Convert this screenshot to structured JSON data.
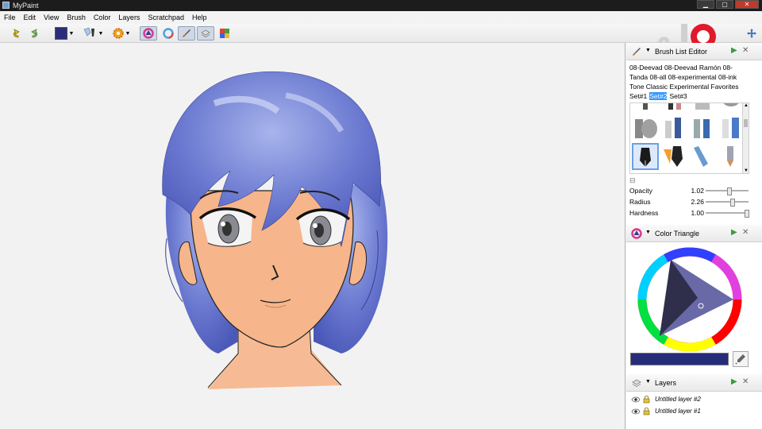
{
  "window": {
    "title": "MyPaint",
    "min_label": "▁",
    "max_label": "▢",
    "close_label": "✕"
  },
  "menu": [
    "File",
    "Edit",
    "View",
    "Brush",
    "Color",
    "Layers",
    "Scratchpad",
    "Help"
  ],
  "toolbar": {
    "current_color": "#2b2d7a"
  },
  "brush_panel": {
    "title": "Brush List Editor",
    "groups_line1": "08-Deevad 08-Deevad Ramón 08-",
    "groups_line2": "Tanda 08-all 08-experimental 08-ink",
    "groups_line3": "Tone Classic Experimental Favorites",
    "sets": [
      "Set#1",
      "Set#2",
      "Set#3"
    ],
    "selected_set": "Set#2",
    "collapse_label": "⊟",
    "sliders": [
      {
        "label": "Opacity",
        "value": "1.02",
        "position": 0.55
      },
      {
        "label": "Radius",
        "value": "2.26",
        "position": 0.62
      },
      {
        "label": "Hardness",
        "value": "1.00",
        "position": 1.0
      }
    ]
  },
  "color_panel": {
    "title": "Color Triangle",
    "selected_color": "#252d78"
  },
  "layers_panel": {
    "title": "Layers",
    "layers": [
      "Untitled layer #2",
      "Untitled layer #1"
    ]
  },
  "colors": {
    "accent": "#3399ff",
    "hair": "#5566c8",
    "skin": "#f6b58a",
    "dock_green": "#3a9c3a",
    "dock_close": "#666666"
  }
}
